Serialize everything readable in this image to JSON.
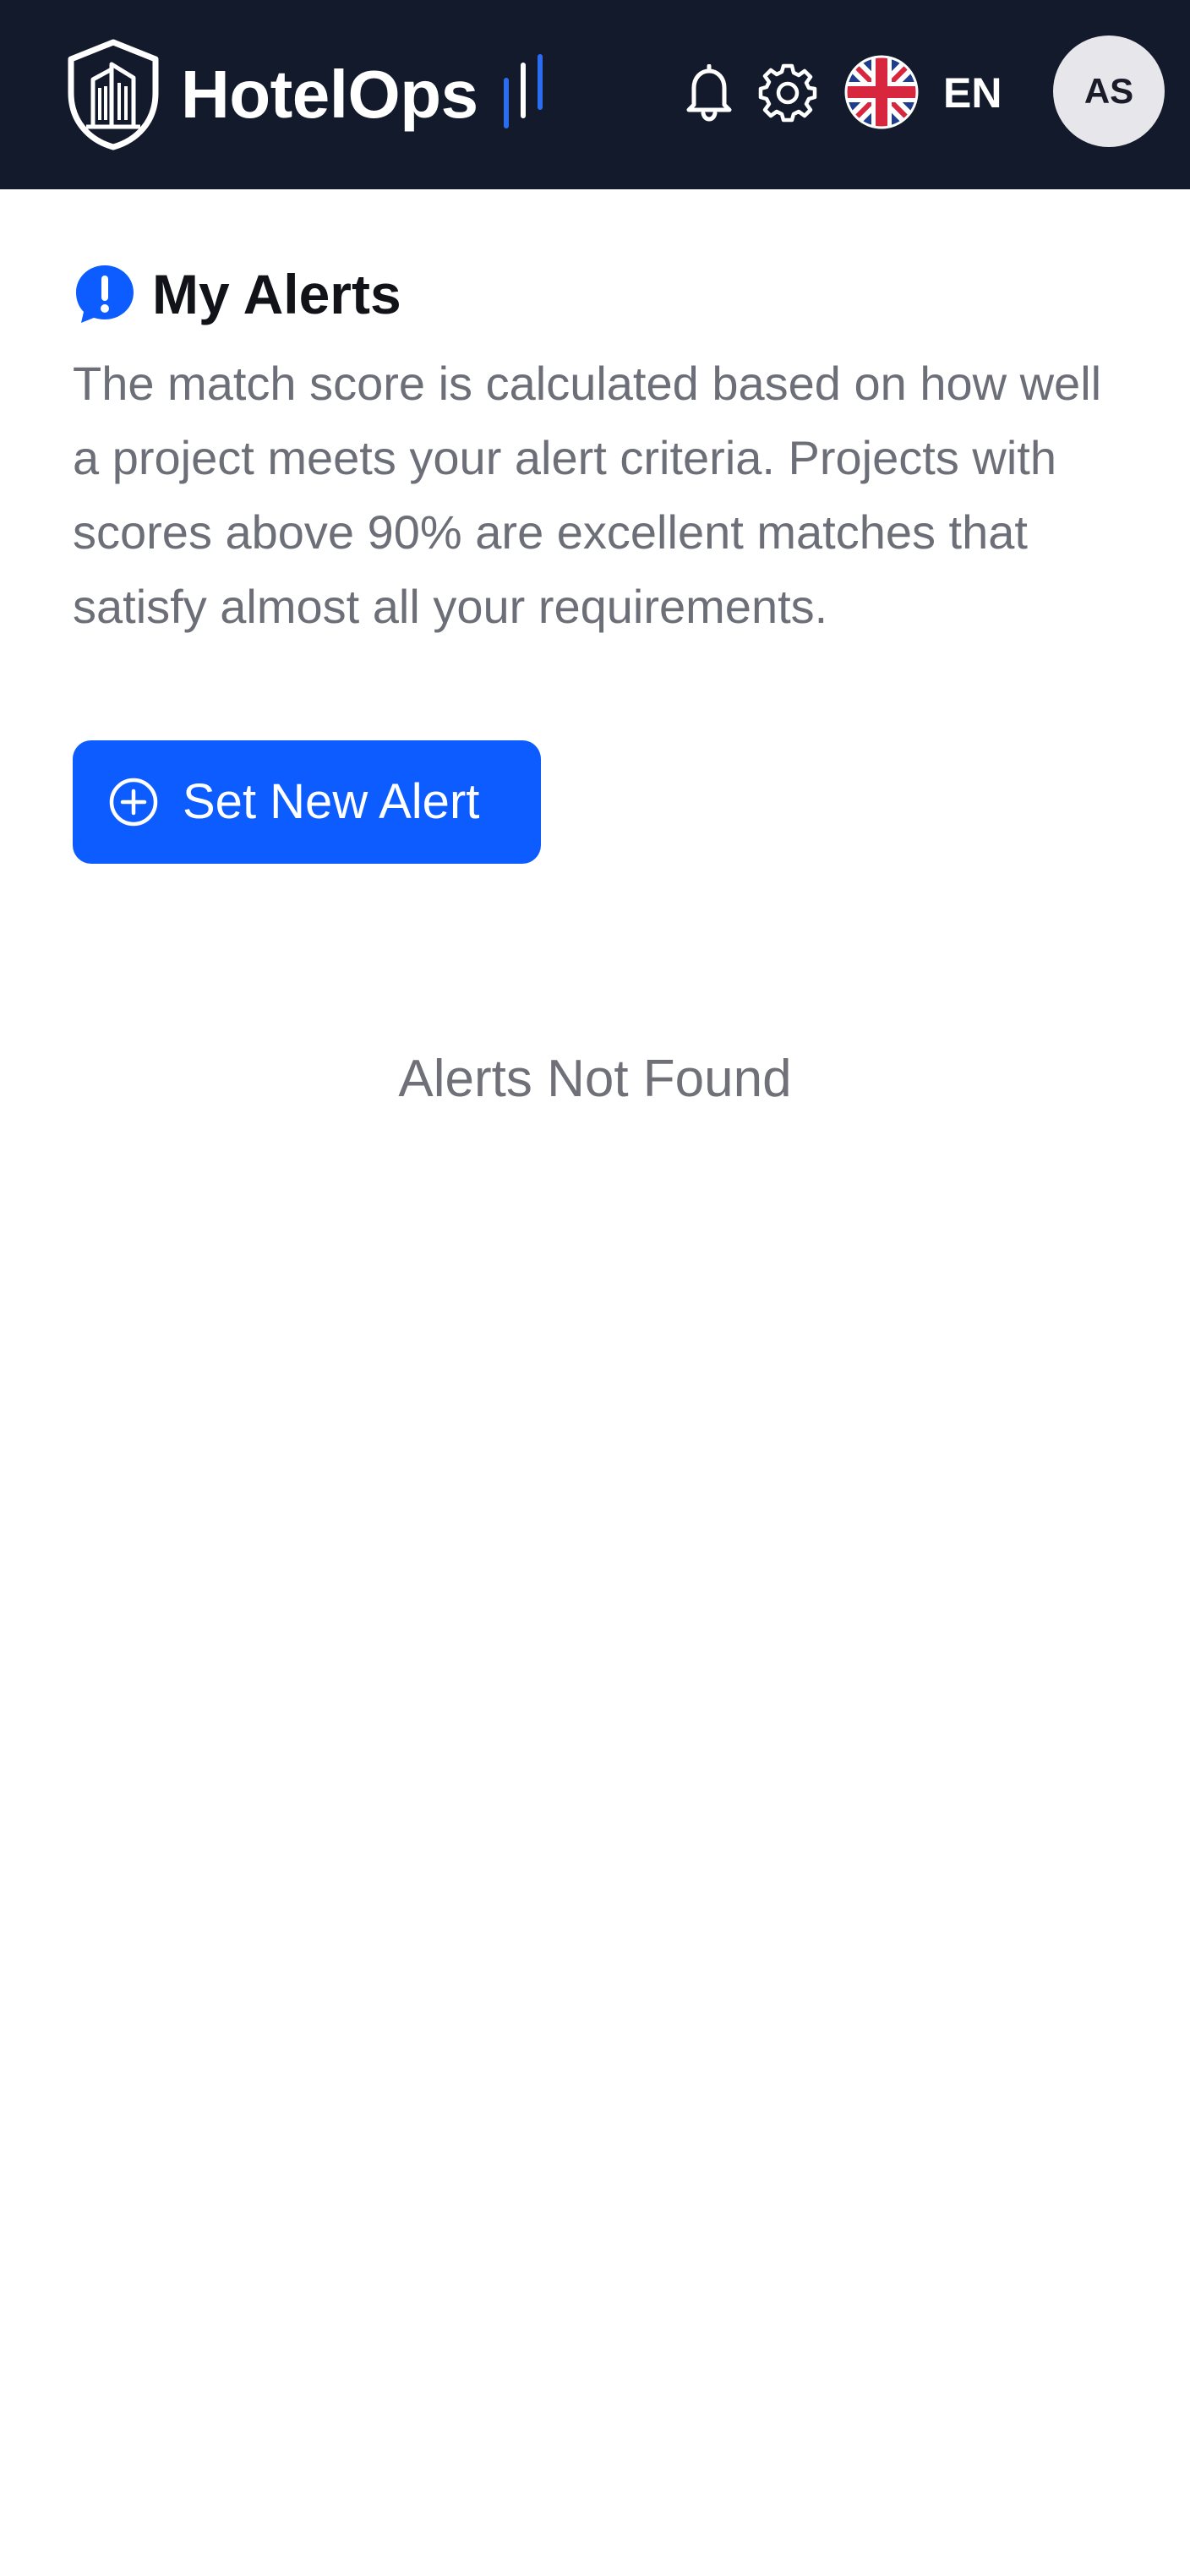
{
  "header": {
    "brand_name": "HotelOps",
    "logo_icon": "shield-building-icon",
    "notifications_icon": "bell-icon",
    "settings_icon": "gear-icon",
    "language_flag_icon": "uk-flag-icon",
    "language_code": "EN",
    "user_initials": "AS",
    "background_color": "#131a2c",
    "accent_color": "#2563eb"
  },
  "main": {
    "title": "My Alerts",
    "title_icon": "alert-exclamation-icon",
    "description": "The match score is calculated based on how well a project meets your alert criteria. Projects with scores above 90% are excellent matches that satisfy almost all your requirements.",
    "new_alert_button": {
      "label": "Set New Alert",
      "icon": "plus-circle-icon",
      "color": "#0d5cff"
    },
    "empty_state_text": "Alerts Not Found"
  }
}
